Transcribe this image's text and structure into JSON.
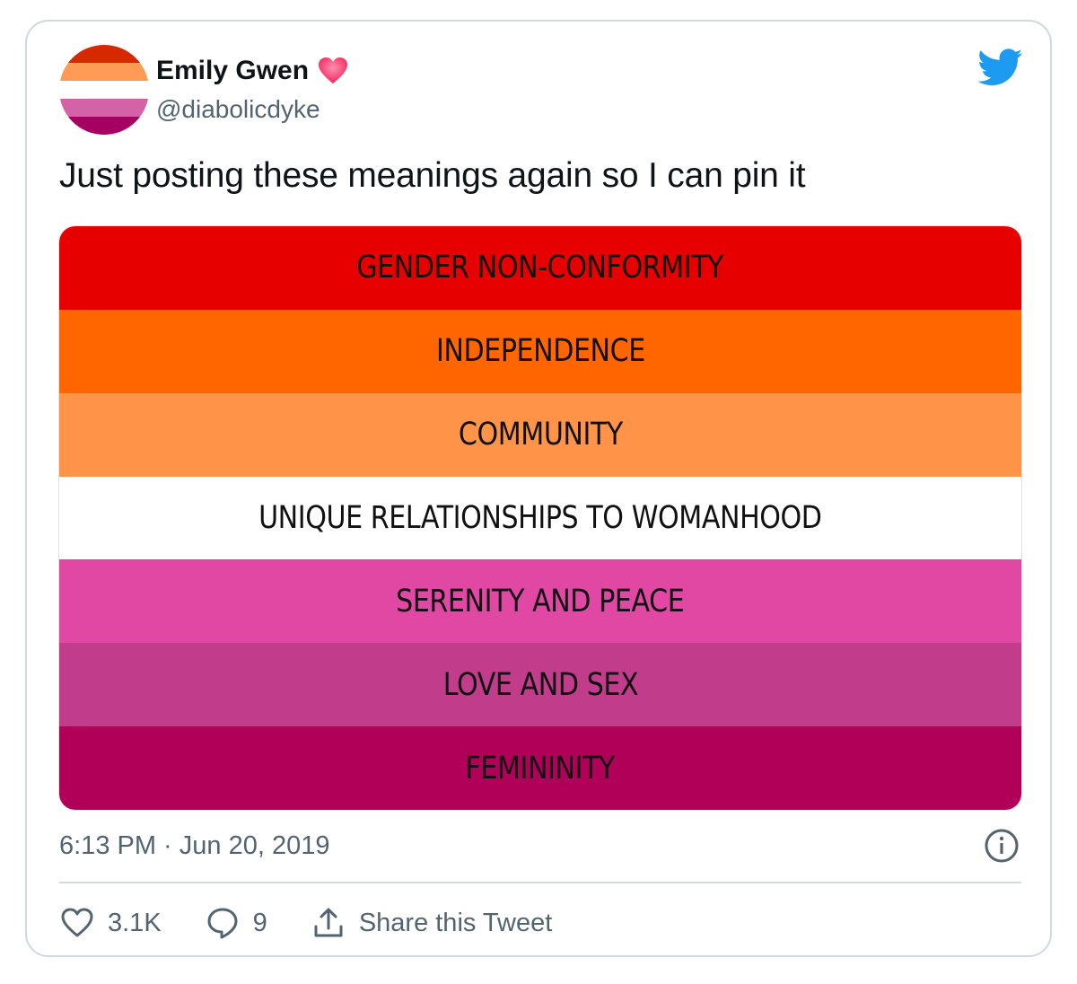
{
  "author": {
    "name": "Emily Gwen",
    "handle": "@diabolicdyke",
    "avatar_stripes": [
      "#d62900",
      "#ff9b55",
      "#ffffff",
      "#d462a6",
      "#a50062"
    ]
  },
  "icons": {
    "heart_emoji": "heart-emoji-icon",
    "brand": "twitter-bird-icon",
    "info": "info-icon",
    "like": "heart-outline-icon",
    "reply": "speech-bubble-icon",
    "share": "share-arrow-icon"
  },
  "tweet": {
    "text": "Just posting these meanings again so I can pin it"
  },
  "flag": {
    "stripes": [
      {
        "label": "GENDER NON-CONFORMITY",
        "color": "#e60000"
      },
      {
        "label": "INDEPENDENCE",
        "color": "#ff6600"
      },
      {
        "label": "COMMUNITY",
        "color": "#ff9448"
      },
      {
        "label": "UNIQUE RELATIONSHIPS TO WOMANHOOD",
        "color": "#ffffff"
      },
      {
        "label": "SERENITY AND PEACE",
        "color": "#e048a4"
      },
      {
        "label": "LOVE AND SEX",
        "color": "#c23c8c"
      },
      {
        "label": "FEMININITY",
        "color": "#b00058"
      }
    ]
  },
  "meta": {
    "timestamp": "6:13 PM · Jun 20, 2019"
  },
  "actions": {
    "likes": "3.1K",
    "replies": "9",
    "share_label": "Share this Tweet"
  },
  "colors": {
    "twitter_blue": "#1d9bf0",
    "heart_pink": "#f4245e",
    "muted_text": "#536471"
  }
}
